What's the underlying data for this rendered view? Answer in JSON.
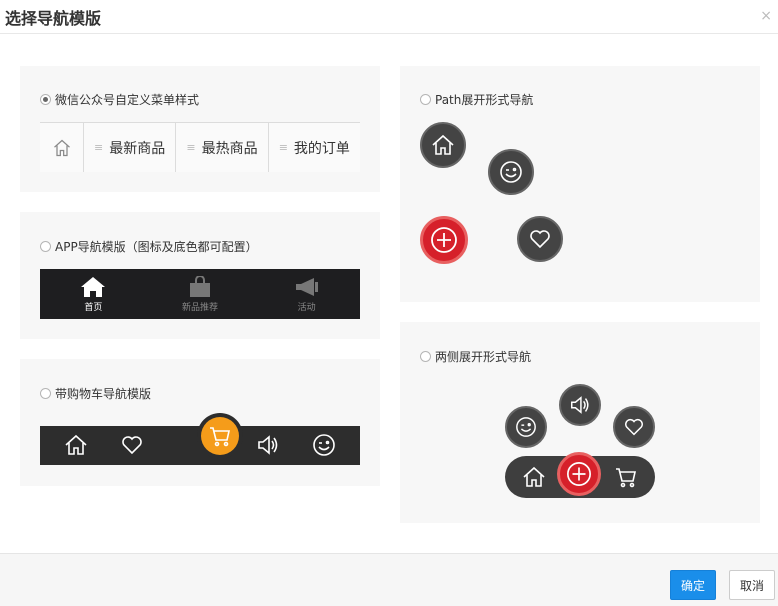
{
  "dialog": {
    "title": "选择导航模版",
    "close": "×"
  },
  "templates": {
    "wechat": {
      "label": "微信公众号自定义菜单样式",
      "items": [
        "最新商品",
        "最热商品",
        "我的订单"
      ]
    },
    "app": {
      "label": "APP导航模版（图标及底色都可配置）",
      "tabs": [
        "首页",
        "新品推荐",
        "活动"
      ]
    },
    "cart": {
      "label": "带购物车导航模版"
    },
    "path": {
      "label": "Path展开形式导航"
    },
    "sides": {
      "label": "两侧展开形式导航"
    }
  },
  "colors": {
    "accent": "#f59c1a",
    "plus": "#d6202a",
    "primary": "#1a8eea"
  },
  "footer": {
    "ok": "确定",
    "cancel": "取消"
  }
}
